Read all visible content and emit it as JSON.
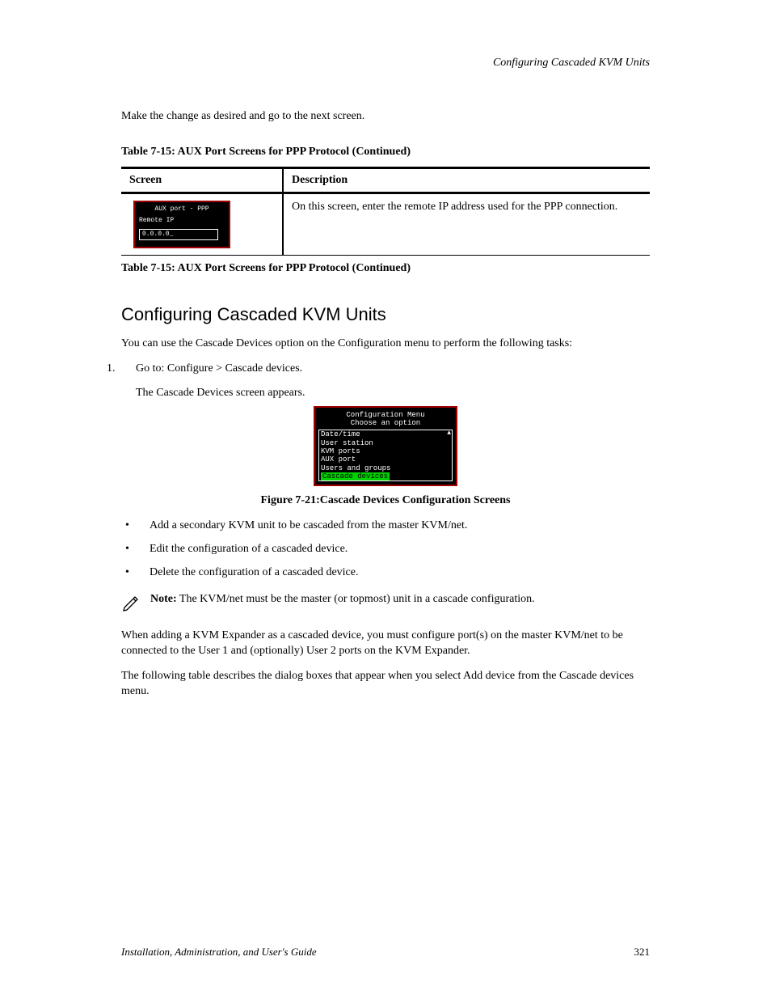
{
  "header_right": "Configuring Cascaded KVM Units",
  "instruction": "Make the change as desired and go to the next screen.",
  "table_caption": "Table 7-15: AUX Port Screens for PPP Protocol (Continued)",
  "table": {
    "col1": "Screen",
    "col2": "Description",
    "row_desc": "On this screen, enter the remote IP address used for the PPP connection."
  },
  "osd1": {
    "title": "AUX port - PPP",
    "label": "Remote IP",
    "value": "0.0.0.0_"
  },
  "end_caption": "Table 7-15: AUX Port Screens for PPP Protocol (Continued)",
  "section_title": "Configuring Cascaded KVM Units",
  "intro": "You can use the Cascade Devices option on the Configuration menu to perform the following tasks:",
  "step_1": "Go to: Configure > Cascade devices.",
  "step_label": "The Cascade Devices screen appears.",
  "osd2": {
    "title1": "Configuration Menu",
    "title2": "Choose an option",
    "items": [
      "Date/time",
      "User station",
      "KVM ports",
      "AUX port",
      "Users and groups",
      "Cascade devices"
    ],
    "selected_index": 5
  },
  "fig_caption": "Figure 7-21:Cascade Devices Configuration Screens",
  "bullets": [
    "Add a secondary KVM unit to be cascaded from the master KVM/net.",
    "Edit the configuration of a cascaded device.",
    "Delete the configuration of a cascaded device."
  ],
  "note": {
    "label": "Note:",
    "text": "The KVM/net must be the master (or topmost) unit in a cascade configuration."
  },
  "post_note_1": "When adding a KVM Expander as a cascaded device, you must configure port(s) on the master KVM/net to be connected to the User 1 and (optionally) User 2 ports on the KVM Expander.",
  "post_note_2": "The following table describes the dialog boxes that appear when you select Add device from the Cascade devices menu.",
  "footer_left": "Installation, Administration, and User's Guide",
  "footer_right": "321"
}
